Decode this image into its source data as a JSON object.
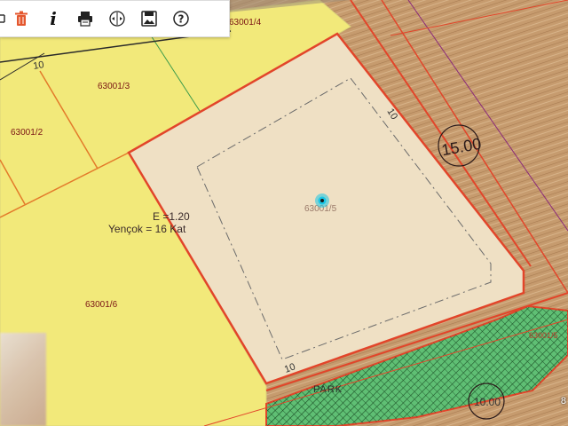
{
  "toolbar": {
    "buttons": [
      {
        "name": "partial-left-icon"
      },
      {
        "name": "trash-icon"
      },
      {
        "name": "info-icon",
        "glyph": "i"
      },
      {
        "name": "print-icon"
      },
      {
        "name": "measure-icon"
      },
      {
        "name": "export-image-icon"
      },
      {
        "name": "help-icon",
        "glyph": "?"
      }
    ]
  },
  "map": {
    "parcels": [
      {
        "id": "63001/4"
      },
      {
        "id": "63001/3"
      },
      {
        "id": "63001/2"
      },
      {
        "id": "63001/6"
      },
      {
        "id": "63001/5"
      },
      {
        "id": "63001/5",
        "note": "63001/5"
      }
    ],
    "selected_parcel_label": "63001/5",
    "parcel_labels": {
      "p4": "63001/4",
      "p3": "63001/3",
      "p2": "63001/2",
      "p6": "63001/6",
      "p5": "63001/5"
    },
    "zoning": {
      "emsal": "E =1.20",
      "height": "Yençok = 16 Kat"
    },
    "dimensions": {
      "top_left": "10",
      "right_side": "10",
      "bottom": "10",
      "road_right": "15.00",
      "road_bottom": "10.00"
    },
    "park_label": "PARK",
    "corner_text": "8",
    "marker_color": "#19c6e6",
    "colors": {
      "residential": "#f2e97a",
      "selected": "#efe0c4",
      "park": "#3fa65a",
      "boundary": "#e2452a"
    }
  }
}
